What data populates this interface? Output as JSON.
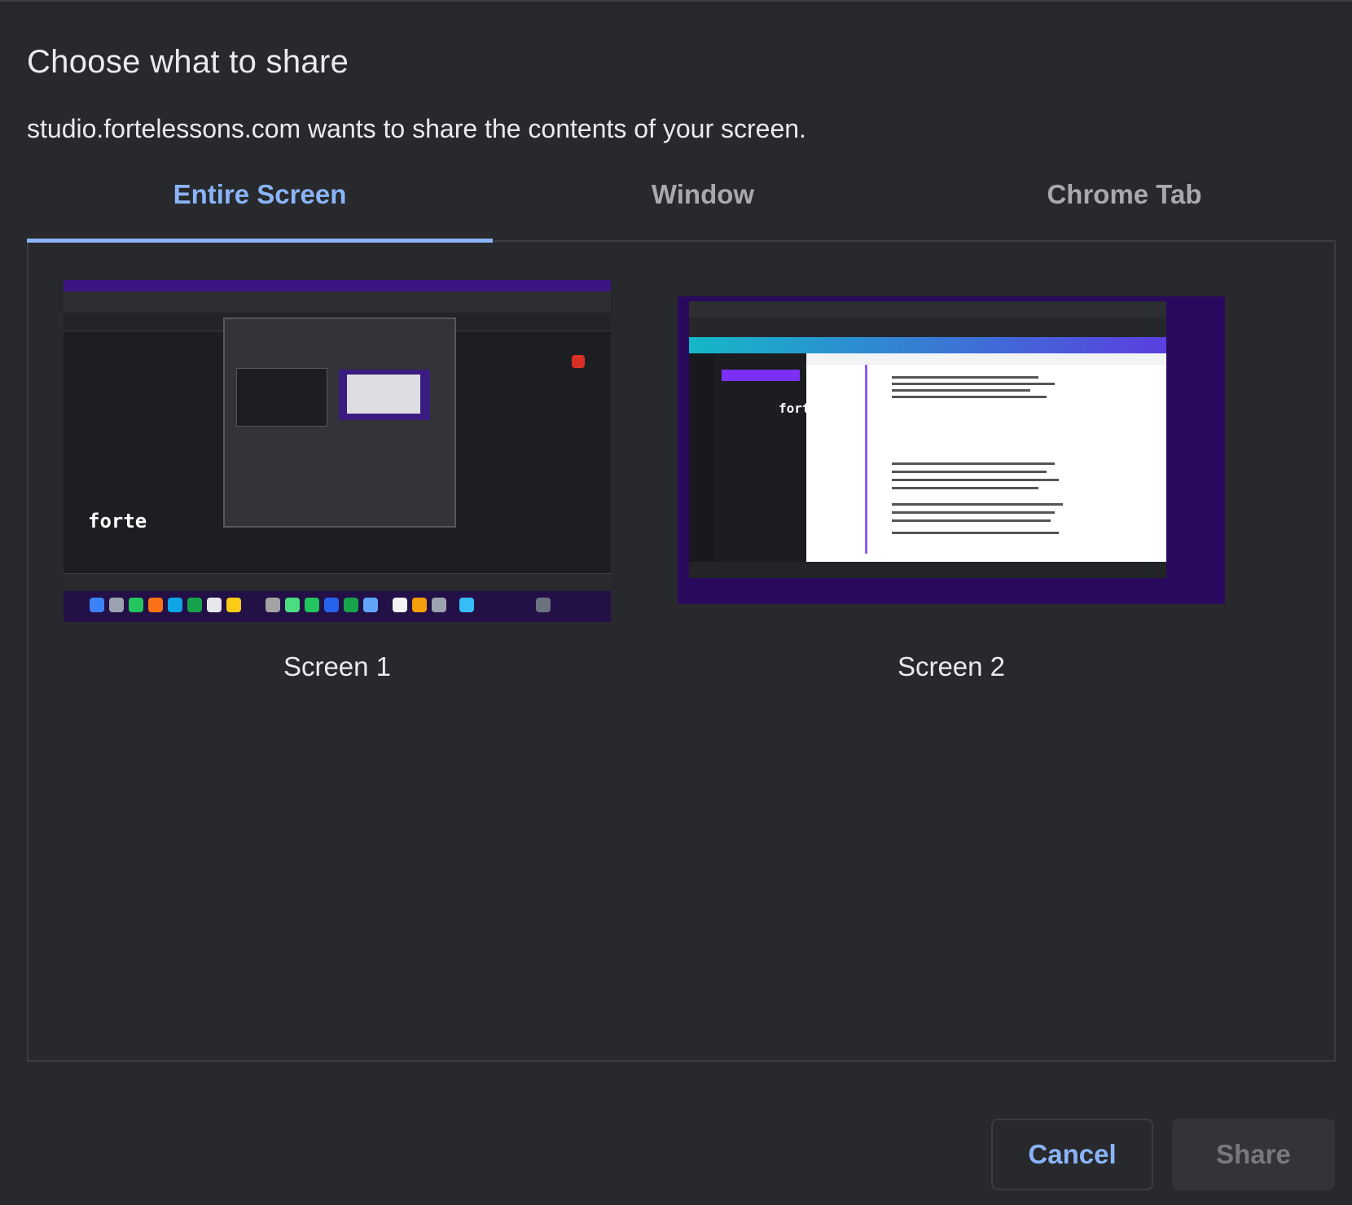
{
  "dialog": {
    "title": "Choose what to share",
    "subtitle": "studio.fortelessons.com wants to share the contents of your screen."
  },
  "tabs": [
    {
      "label": "Entire Screen",
      "active": true
    },
    {
      "label": "Window",
      "active": false
    },
    {
      "label": "Chrome Tab",
      "active": false
    }
  ],
  "sources": [
    {
      "label": "Screen 1",
      "thumbnail_logo": "forte"
    },
    {
      "label": "Screen 2",
      "thumbnail_logo": "forte"
    }
  ],
  "buttons": {
    "cancel_label": "Cancel",
    "share_label": "Share"
  },
  "colors": {
    "accent": "#8ab4f8",
    "background": "#28292c",
    "text": "#e8eaed",
    "inactive_tab": "#a7a9ad",
    "disabled_button_text": "#77797c"
  }
}
